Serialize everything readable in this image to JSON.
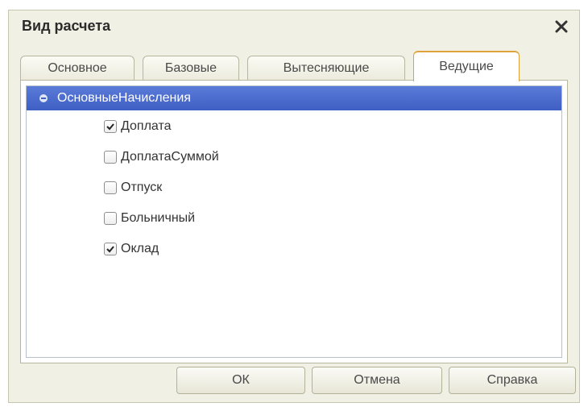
{
  "window": {
    "title": "Вид расчета"
  },
  "tabs": [
    {
      "label": "Основное",
      "active": false
    },
    {
      "label": "Базовые",
      "active": false
    },
    {
      "label": "Вытесняющие",
      "active": false
    },
    {
      "label": "Ведущие",
      "active": true
    }
  ],
  "tree": {
    "root_label": "ОсновныеНачисления",
    "items": [
      {
        "label": "Доплата",
        "checked": true
      },
      {
        "label": "ДоплатаСуммой",
        "checked": false
      },
      {
        "label": "Отпуск",
        "checked": false
      },
      {
        "label": "Больничный",
        "checked": false
      },
      {
        "label": "Оклад",
        "checked": true
      }
    ]
  },
  "buttons": {
    "ok": "ОК",
    "cancel": "Отмена",
    "help": "Справка"
  },
  "colors": {
    "selection": "#3f5fc4",
    "active_tab_border": "#e0a33c",
    "window_bg": "#f1f0e4"
  }
}
